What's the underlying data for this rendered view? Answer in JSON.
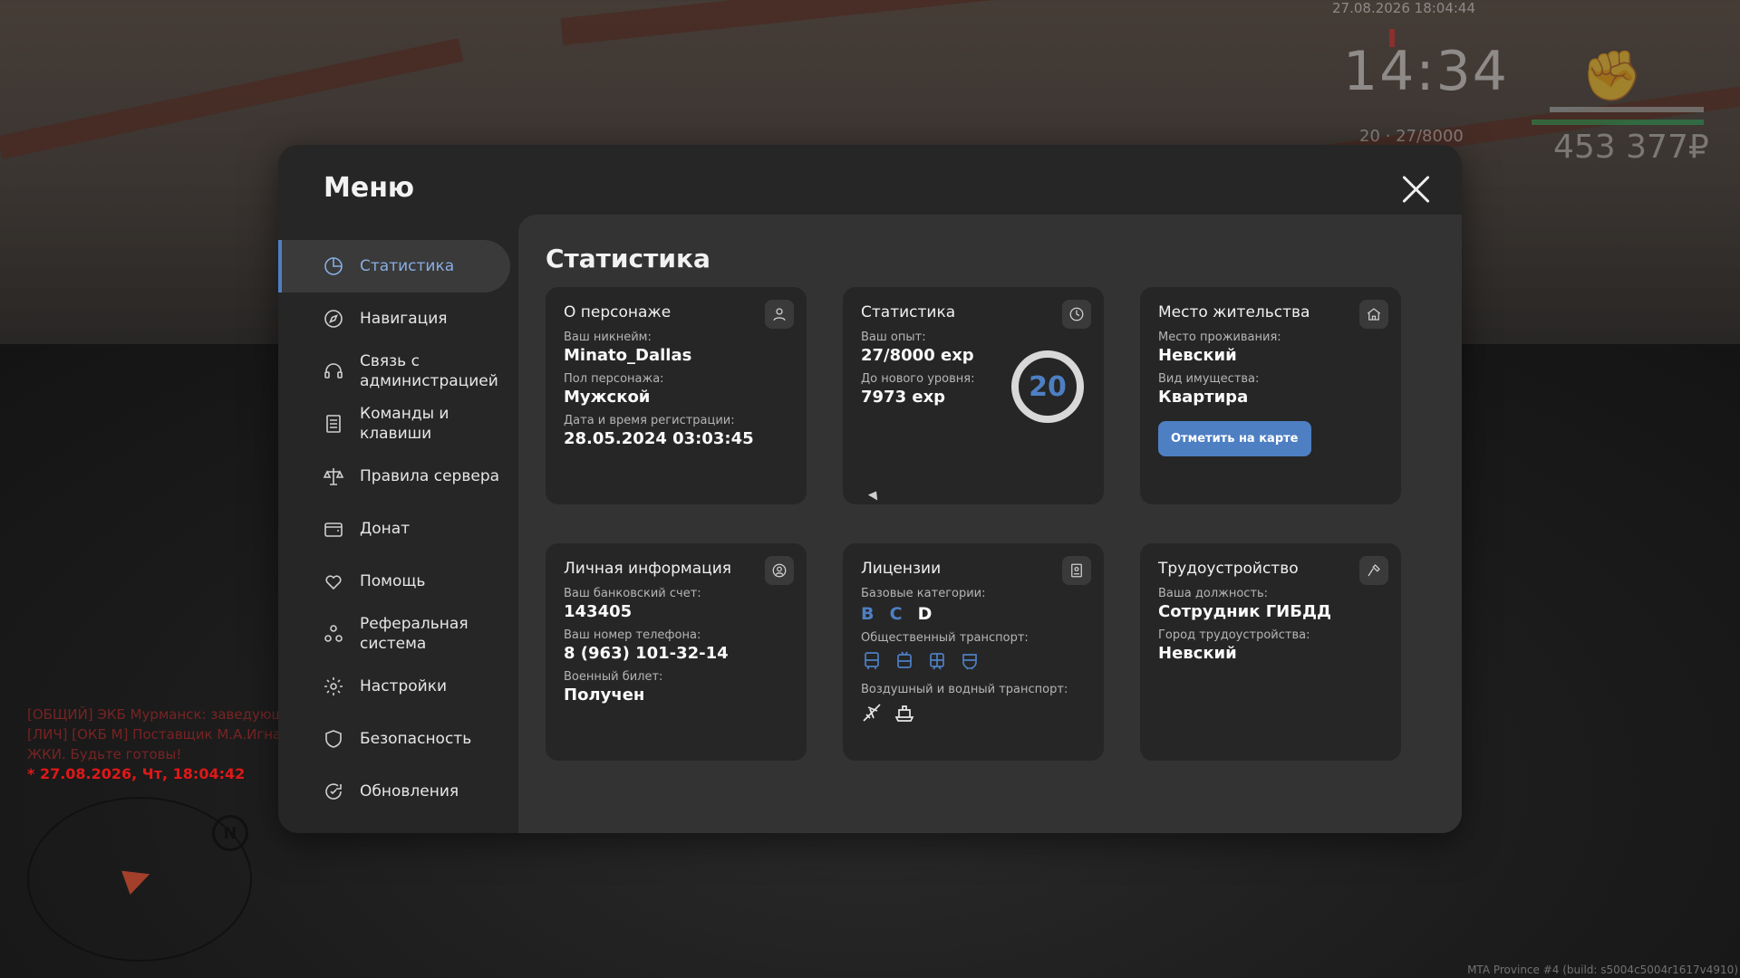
{
  "hud": {
    "datetime": "27.08.2026 18:04:44",
    "clock": "14:34",
    "level_exp": "20 · 27/8000",
    "money": "453 377₽"
  },
  "chat": {
    "lines": [
      "[ОБЩИЙ] ЭКБ Мурманск: заведующий отдела мед.помощи...",
      "[ЛИЧ] [ОКБ М] Поставщик М.А.Игнатьев: Внимание!!",
      "ЖКИ. Будьте готовы!"
    ],
    "date_line": "* 27.08.2026, Чт, 18:04:42"
  },
  "radar": {
    "north": "N"
  },
  "build": "MTA Province #4 (build: s5004c5004r1617v4910)",
  "menu": {
    "title": "Меню",
    "nav": [
      {
        "label": "Статистика",
        "icon": "pie-chart-icon",
        "active": true
      },
      {
        "label": "Навигация",
        "icon": "compass-icon",
        "active": false
      },
      {
        "label": "Связь с администрацией",
        "icon": "headset-icon",
        "active": false
      },
      {
        "label": "Команды и клавиши",
        "icon": "list-icon",
        "active": false
      },
      {
        "label": "Правила сервера",
        "icon": "scales-icon",
        "active": false
      },
      {
        "label": "Донат",
        "icon": "wallet-icon",
        "active": false
      },
      {
        "label": "Помощь",
        "icon": "heart-hand-icon",
        "active": false
      },
      {
        "label": "Реферальная система",
        "icon": "users-icon",
        "active": false
      },
      {
        "label": "Настройки",
        "icon": "gear-icon",
        "active": false
      },
      {
        "label": "Безопасность",
        "icon": "shield-icon",
        "active": false
      },
      {
        "label": "Обновления",
        "icon": "refresh-icon",
        "active": false
      }
    ]
  },
  "content": {
    "title": "Статистика",
    "character": {
      "title": "О персонаже",
      "nick_label": "Ваш никнейм:",
      "nick": "Minato_Dallas",
      "gender_label": "Пол персонажа:",
      "gender": "Мужской",
      "reg_label": "Дата и время регистрации:",
      "reg": "28.05.2024 03:03:45"
    },
    "stats": {
      "title": "Статистика",
      "exp_label": "Ваш опыт:",
      "exp": "27/8000 exp",
      "next_label": "До нового уровня:",
      "next": "7973 exp",
      "level": "20"
    },
    "residence": {
      "title": "Место жительства",
      "place_label": "Место проживания:",
      "place": "Невский",
      "property_label": "Вид имущества:",
      "property": "Квартира",
      "button": "Отметить на карте"
    },
    "personal": {
      "title": "Личная информация",
      "bank_label": "Ваш банковский счет:",
      "bank": "143405",
      "phone_label": "Ваш номер телефона:",
      "phone": "8 (963) 101-32-14",
      "military_label": "Военный билет:",
      "military": "Получен"
    },
    "licenses": {
      "title": "Лицензии",
      "base_label": "Базовые категории:",
      "categories": [
        "B",
        "C",
        "D"
      ],
      "public_label": "Общественный транспорт:",
      "air_label": "Воздушный и водный транспорт:"
    },
    "job": {
      "title": "Трудоустройство",
      "position_label": "Ваша должность:",
      "position": "Сотрудник ГИБДД",
      "city_label": "Город трудоустройства:",
      "city": "Невский"
    }
  },
  "colors": {
    "accent": "#4e7fc3",
    "panel": "#262626",
    "content_bg": "#333333"
  }
}
